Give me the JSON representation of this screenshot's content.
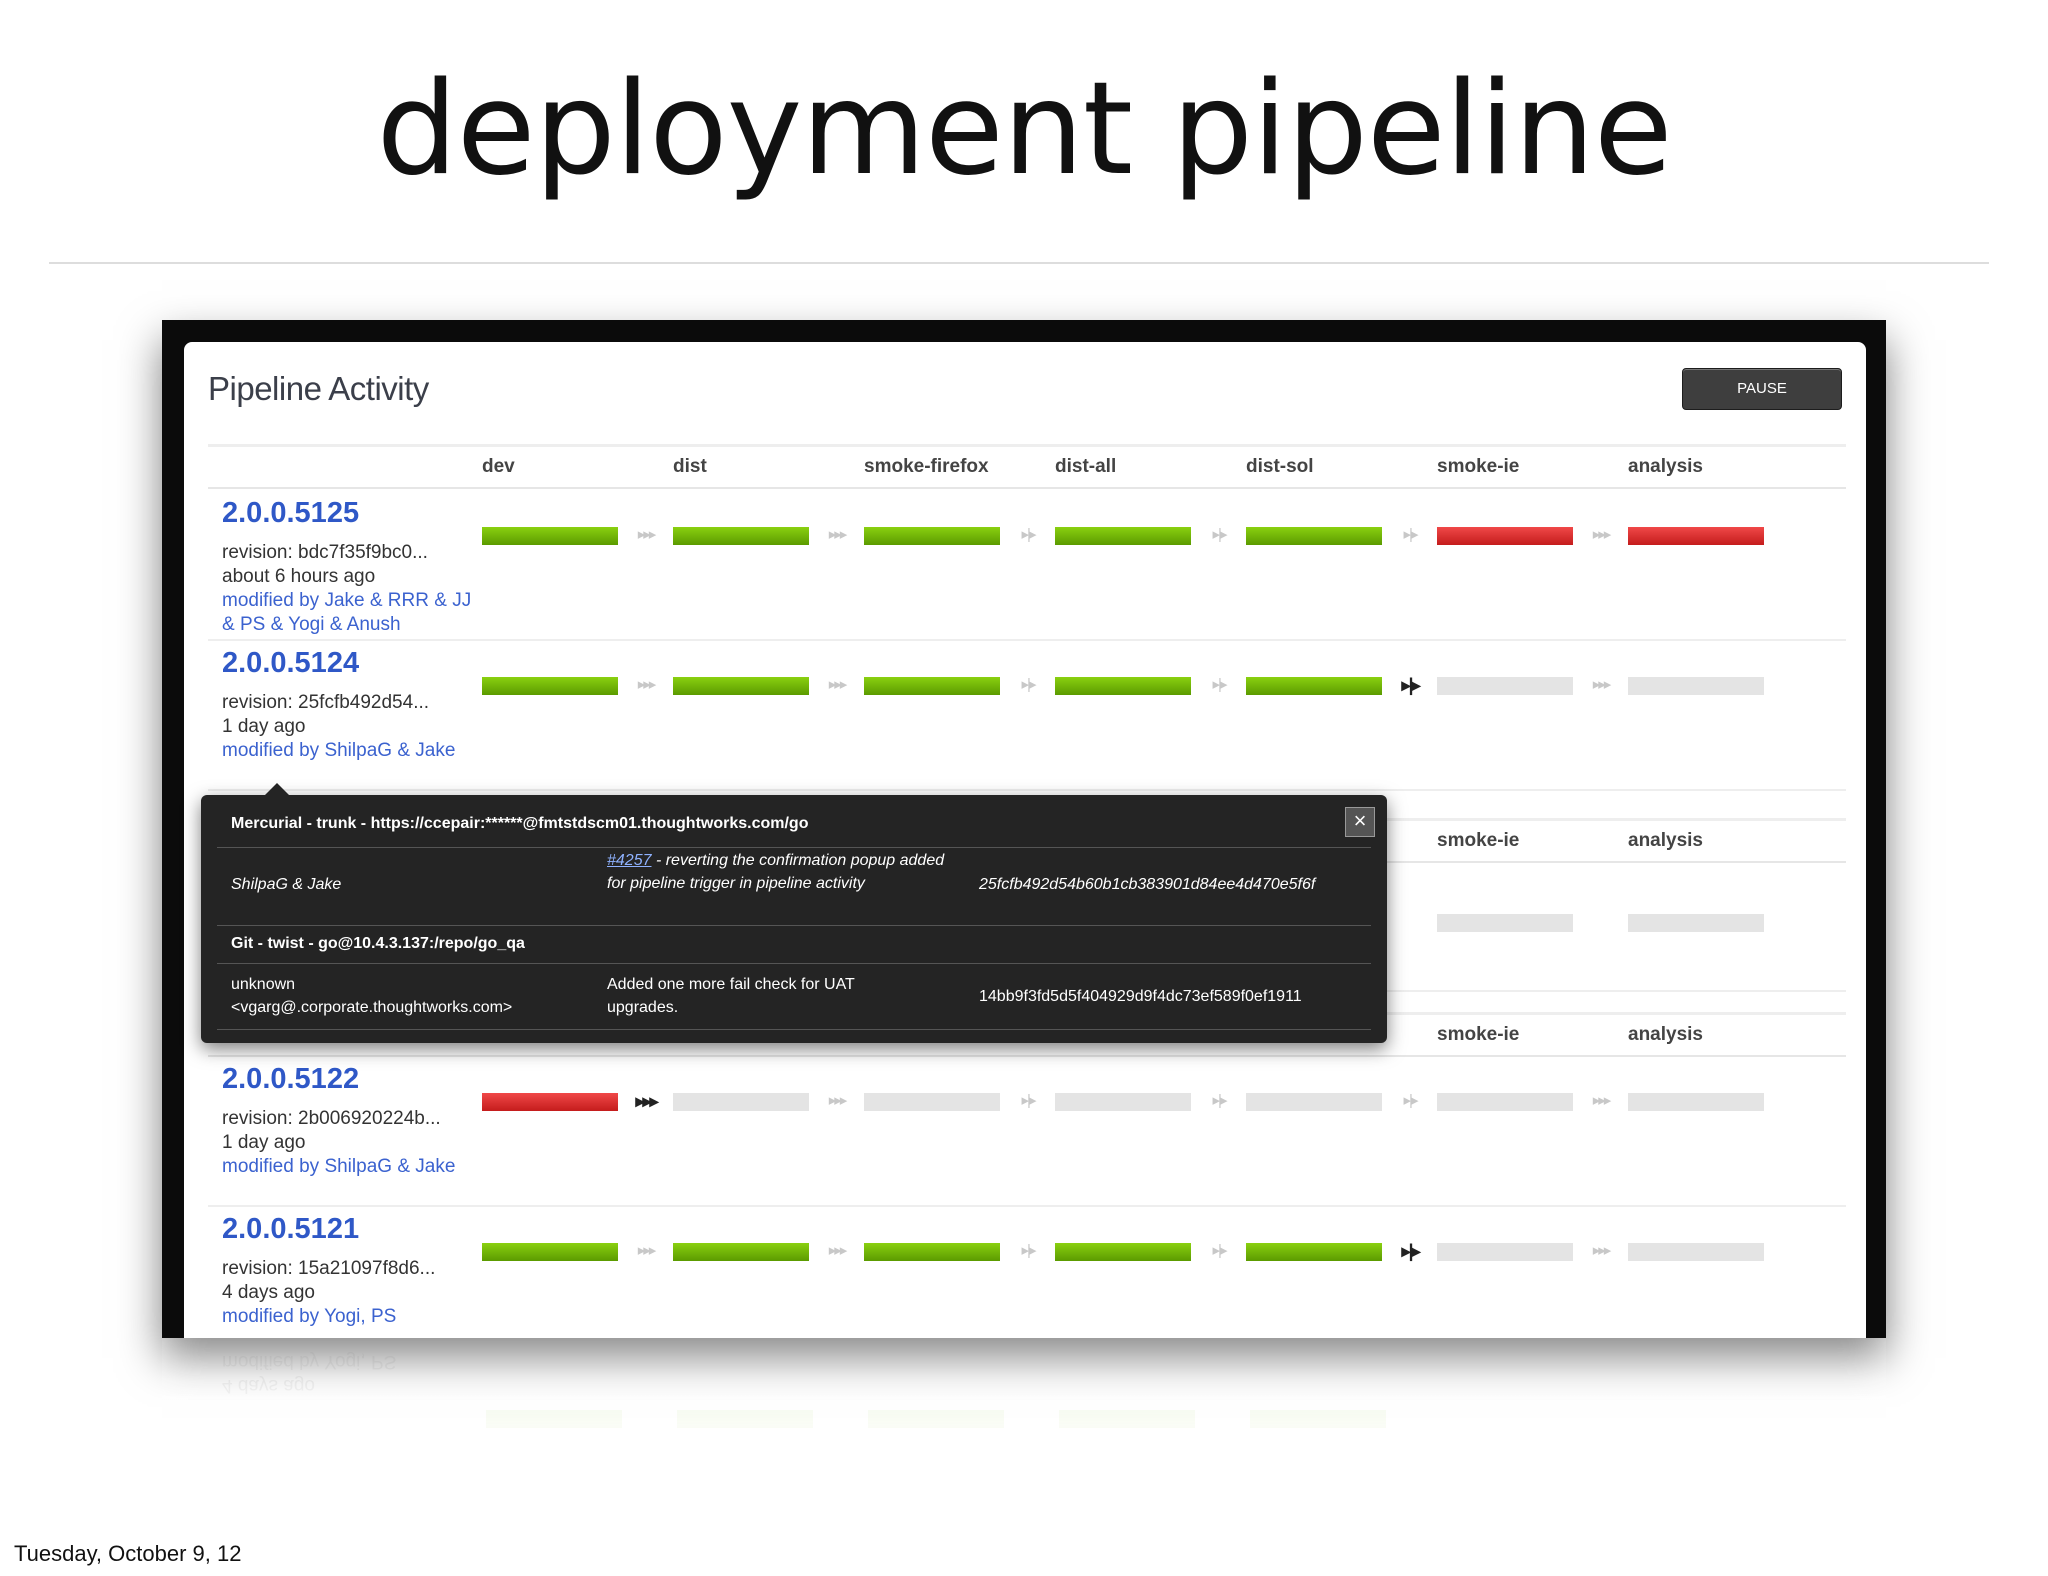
{
  "slide": {
    "title": "deployment pipeline",
    "footer": "Tuesday, October 9, 12"
  },
  "panel": {
    "title": "Pipeline Activity",
    "pause_label": "PAUSE"
  },
  "stages": [
    "dev",
    "dist",
    "smoke-firefox",
    "dist-all",
    "dist-sol",
    "smoke-ie",
    "analysis"
  ],
  "runs": [
    {
      "version": "2.0.0.5125",
      "revision": "revision: bdc7f35f9bc0...",
      "age": "about 6 hours ago",
      "modified": "modified by Jake & RRR & JJ & PS & Yogi & Anush",
      "statuses": [
        "passed",
        "passed",
        "passed",
        "passed",
        "passed",
        "failed",
        "failed"
      ]
    },
    {
      "version": "2.0.0.5124",
      "revision": "revision: 25fcfb492d54...",
      "age": "1 day ago",
      "modified": "modified by ShilpaG & Jake",
      "statuses": [
        "passed",
        "passed",
        "passed",
        "passed",
        "passed",
        "pending",
        "pending"
      ]
    },
    {
      "version": "2.0.0.5122",
      "revision": "revision: 2b006920224b...",
      "age": "1 day ago",
      "modified": "modified by ShilpaG & Jake",
      "statuses": [
        "failed",
        "pending",
        "pending",
        "pending",
        "pending",
        "pending",
        "pending"
      ]
    },
    {
      "version": "2.0.0.5121",
      "revision": "revision: 15a21097f8d6...",
      "age": "4 days ago",
      "modified": "modified by Yogi, PS",
      "statuses": [
        "passed",
        "passed",
        "passed",
        "passed",
        "passed",
        "pending",
        "pending"
      ]
    }
  ],
  "popup": {
    "close_label": "×",
    "mercurial_header": "Mercurial - trunk - https://ccepair:******@fmtstdscm01.thoughtworks.com/go",
    "mercurial_author": "ShilpaG & Jake",
    "mercurial_link": "#4257",
    "mercurial_comment": " - reverting the confirmation popup added for pipeline trigger in pipeline activity",
    "mercurial_rev": "25fcfb492d54b60b1cb383901d84ee4d470e5f6f",
    "git_header": "Git - twist - go@10.4.3.137:/repo/go_qa",
    "git_author": "unknown <vgarg@.corporate.thoughtworks.com>",
    "git_comment": "Added one more fail check for UAT upgrades.",
    "git_rev": "14bb9f3fd5d5f404929d9f4dc73ef589f0ef1911"
  },
  "partial_headers": {
    "smoke_ie": "smoke-ie",
    "analysis": "analysis"
  },
  "reflection": {
    "line1": "modified by Yogi, PS",
    "line2": "4 days ago"
  },
  "colors": {
    "passed": "#6fb40a",
    "failed": "#d62b2b",
    "pending": "#e4e4e4",
    "link": "#2f58c7"
  },
  "icons": {
    "transition_auto": "triple-chevron-icon",
    "transition_manual": "manual-gate-icon"
  }
}
